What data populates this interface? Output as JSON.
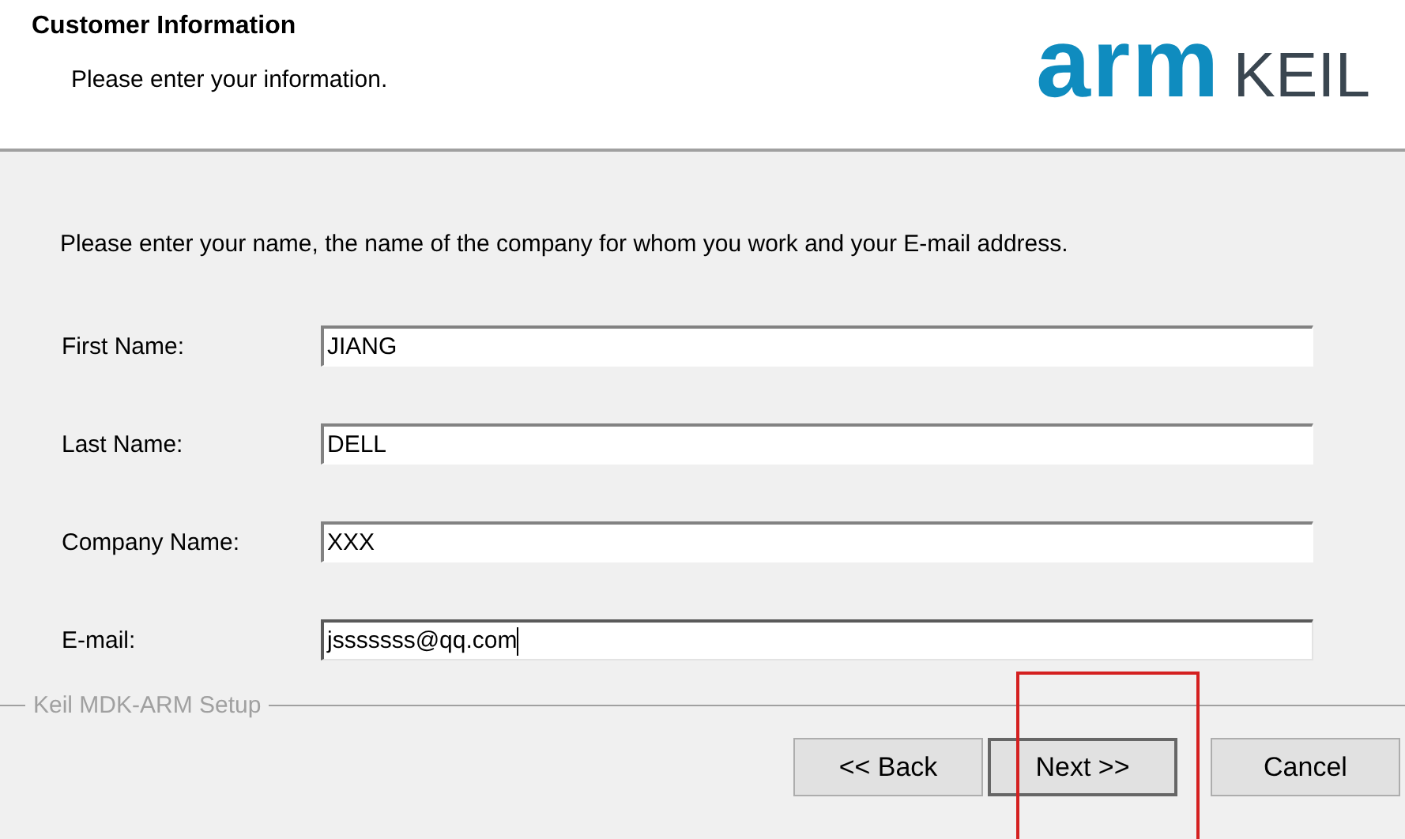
{
  "header": {
    "title": "Customer Information",
    "subtitle": "Please enter your information.",
    "logo": {
      "brand": "arm",
      "product": "KEIL"
    }
  },
  "intro": "Please enter your name, the name of the company for whom you work and your E-mail address.",
  "fields": [
    {
      "label": "First Name:",
      "value": "JIANG",
      "focused": false
    },
    {
      "label": "Last Name:",
      "value": "DELL",
      "focused": false
    },
    {
      "label": "Company Name:",
      "value": "XXX",
      "focused": false
    },
    {
      "label": "E-mail:",
      "value": "jsssssss@qq.com",
      "focused": true
    }
  ],
  "group_label": "Keil MDK-ARM Setup",
  "buttons": [
    {
      "label": "<< Back",
      "default": false,
      "highlighted": false
    },
    {
      "label": "Next >>",
      "default": true,
      "highlighted": true
    },
    {
      "label": "Cancel",
      "default": false,
      "highlighted": false
    }
  ]
}
